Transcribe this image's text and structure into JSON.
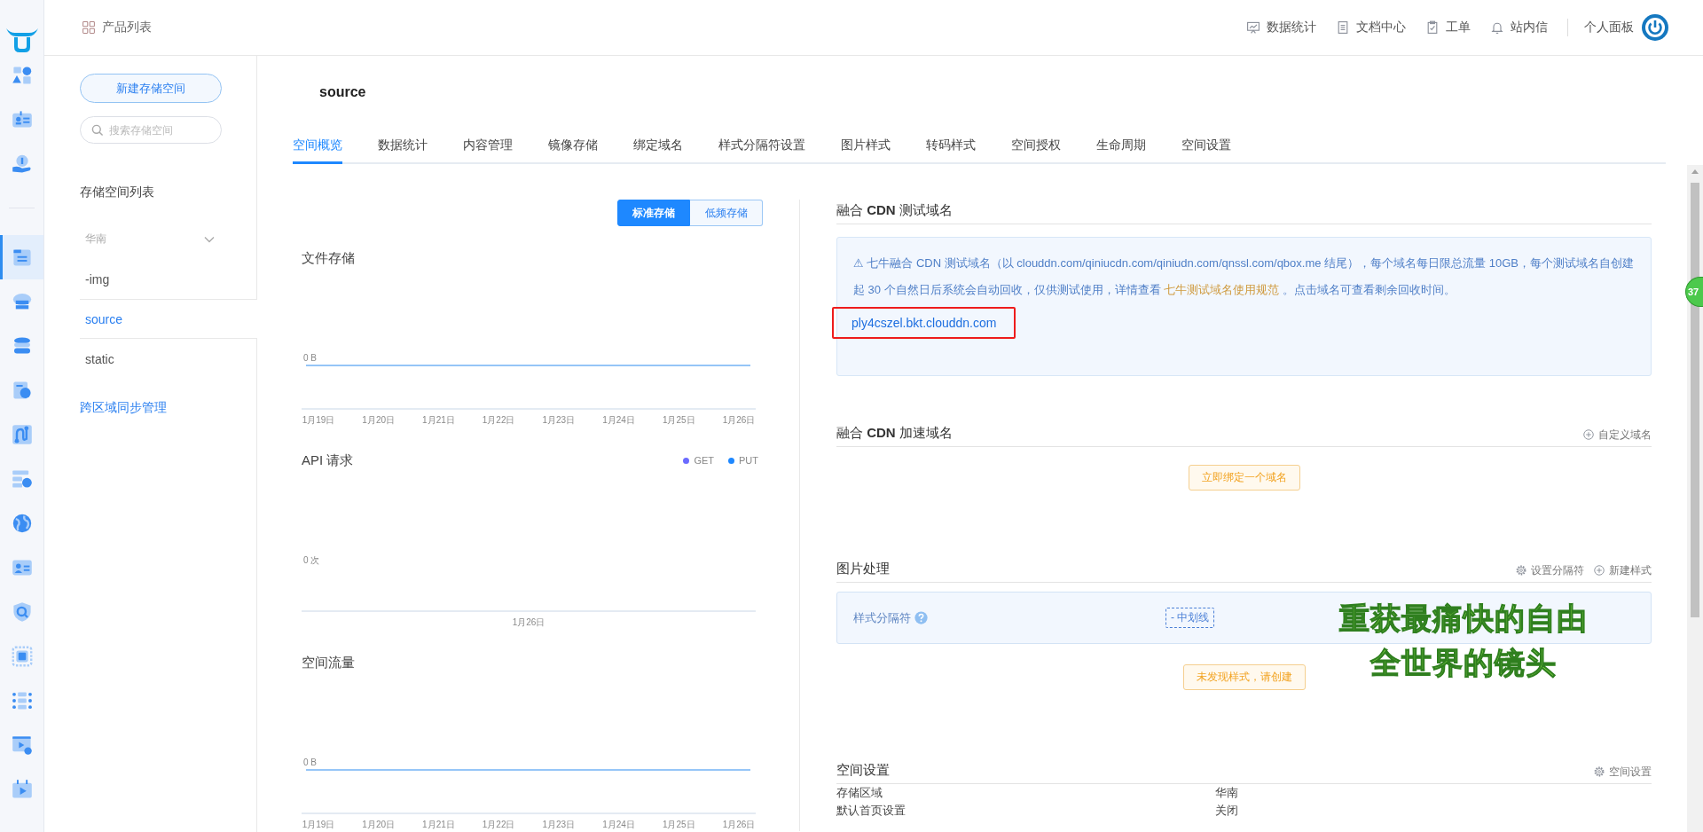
{
  "header": {
    "product_menu": "产品列表",
    "links": [
      {
        "label": "数据统计"
      },
      {
        "label": "文档中心"
      },
      {
        "label": "工单"
      },
      {
        "label": "站内信"
      }
    ],
    "user": "个人面板"
  },
  "rail": {
    "top_items": [
      {
        "selected": false
      },
      {
        "selected": false
      },
      {
        "selected": false
      }
    ],
    "items": [
      {
        "selected": true
      },
      {
        "selected": false
      },
      {
        "selected": false
      },
      {
        "selected": false
      },
      {
        "selected": false
      },
      {
        "selected": false
      },
      {
        "selected": false
      },
      {
        "selected": false
      },
      {
        "selected": false
      },
      {
        "selected": false
      },
      {
        "selected": false
      },
      {
        "selected": false
      },
      {
        "selected": false
      }
    ]
  },
  "sidebar": {
    "create_button": "新建存储空间",
    "search": {
      "placeholder": "搜索存储空间"
    },
    "list_title": "存储空间列表",
    "groups": [
      {
        "label": "华南",
        "expanded": true,
        "children": [
          {
            "label": "-img",
            "selected": false
          },
          {
            "label": "source",
            "selected": true
          },
          {
            "label": "static",
            "selected": false
          }
        ]
      }
    ],
    "sync_link": "跨区域同步管理"
  },
  "page": {
    "title": "source",
    "tabs": [
      {
        "label": "空间概览",
        "selected": true
      },
      {
        "label": "数据统计",
        "selected": false
      },
      {
        "label": "内容管理",
        "selected": false
      },
      {
        "label": "镜像存储",
        "selected": false
      },
      {
        "label": "绑定域名",
        "selected": false
      },
      {
        "label": "样式分隔符设置",
        "selected": false
      },
      {
        "label": "图片样式",
        "selected": false
      },
      {
        "label": "转码样式",
        "selected": false
      },
      {
        "label": "空间授权",
        "selected": false
      },
      {
        "label": "生命周期",
        "selected": false
      },
      {
        "label": "空间设置",
        "selected": false
      }
    ]
  },
  "overview": {
    "storage_toggle": [
      {
        "label": "标准存储",
        "selected": true
      },
      {
        "label": "低频存储",
        "selected": false
      }
    ],
    "charts": [
      {
        "title": "文件存储",
        "kind": "flat-line",
        "y_label": "0 B",
        "x_labels": [
          "1月19日",
          "1月20日",
          "1月21日",
          "1月22日",
          "1月23日",
          "1月24日",
          "1月25日",
          "1月26日"
        ]
      },
      {
        "title": "API 请求",
        "kind": "empty",
        "legend": [
          {
            "label": "GET",
            "color": "#6b6bff"
          },
          {
            "label": "PUT",
            "color": "#1e88ff"
          }
        ],
        "y_label": "0 次",
        "x_labels": [
          "1月26日"
        ]
      },
      {
        "title": "空间流量",
        "kind": "flat-line",
        "y_label": "0 B",
        "x_labels": [
          "1月19日",
          "1月20日",
          "1月21日",
          "1月22日",
          "1月23日",
          "1月24日",
          "1月25日",
          "1月26日"
        ]
      }
    ]
  },
  "test_domain": {
    "heading": "融合 **CDN** 测试域名",
    "notice": "⚠ 七牛融合 CDN 测试域名（以 clouddn.com/qiniucdn.com/qiniudn.com/qnssl.com/qbox.me 结尾），每个域名每日限总流量 10GB，每个测试域名自创建起 30 个自然日后系统会自动回收，仅供测试使用，详情查看 ",
    "notice_link": "七牛测试域名使用规范",
    "notice_tail": " 。点击域名可查看剩余回收时间。",
    "domain": "ply4cszel.bkt.clouddn.com",
    "highlighted": true
  },
  "cdn_domains": {
    "heading": "融合 **CDN** 加速域名",
    "actions": [
      {
        "kind": "plus",
        "label": "自定义域名"
      }
    ],
    "empty_button": "立即绑定一个域名"
  },
  "image_processing": {
    "heading": "图片处理",
    "actions": [
      {
        "kind": "gear",
        "label": "设置分隔符"
      },
      {
        "kind": "plus",
        "label": "新建样式"
      }
    ],
    "separator_label": "样式分隔符",
    "separator_value": "- 中划线",
    "empty_button": "未发现样式，请创建"
  },
  "space_settings": {
    "heading": "空间设置",
    "actions": [
      {
        "kind": "gear",
        "label": "空间设置"
      }
    ],
    "rows": [
      {
        "label": "存储区域",
        "value": "华南"
      },
      {
        "label": "默认首页设置",
        "value": "关闭"
      }
    ]
  },
  "lyrics_overlay": [
    "重获最痛快的自由",
    "全世界的镜头"
  ],
  "floating_badge": "37"
}
